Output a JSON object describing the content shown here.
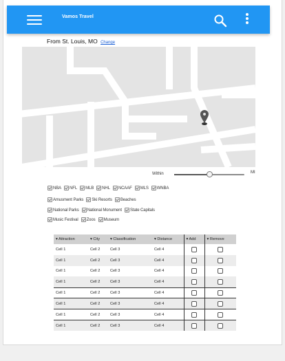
{
  "app": {
    "title": "Vamos Travel",
    "icons": {
      "menu": "hamburger-menu-icon",
      "search": "search-icon",
      "more": "more-vert-icon"
    },
    "brand_color": "#2196f3"
  },
  "location": {
    "text": "From St. Louis, MO",
    "change_label": "Change"
  },
  "map": {
    "marker": "map-pin-icon"
  },
  "distance": {
    "within_label": "Within",
    "unit_label": "MI",
    "value_fraction": 0.5
  },
  "filters": {
    "rows": [
      [
        {
          "label": "NBA",
          "checked": true
        },
        {
          "label": "NFL",
          "checked": true
        },
        {
          "label": "MLB",
          "checked": true
        },
        {
          "label": "NHL",
          "checked": true
        },
        {
          "label": "NCAAF",
          "checked": true
        },
        {
          "label": "MLS",
          "checked": true
        },
        {
          "label": "WNBA",
          "checked": true
        }
      ],
      [
        {
          "label": "Amusment Parks",
          "checked": true
        },
        {
          "label": "Ski Resorts",
          "checked": true
        },
        {
          "label": "Beaches",
          "checked": true
        }
      ],
      [
        {
          "label": "National Parks",
          "checked": true
        },
        {
          "label": "National Monument",
          "checked": true
        },
        {
          "label": "State Capitals",
          "checked": true
        }
      ],
      [
        {
          "label": "Music Festival",
          "checked": true
        },
        {
          "label": "Zoos",
          "checked": true
        },
        {
          "label": "Museum",
          "checked": true
        }
      ]
    ]
  },
  "table": {
    "headers": [
      "▾ Attraction",
      "▾ City",
      "▾ Classification",
      "▾ Distance",
      "▾ Add",
      "▾ Remove"
    ],
    "rows": [
      [
        "Cell 1",
        "Cell 2",
        "Cell 3",
        "Cell 4"
      ],
      [
        "Cell 1",
        "Cell 2",
        "Cell 3",
        "Cell 4"
      ],
      [
        "Cell 1",
        "Cell 2",
        "Cell 3",
        "Cell 4"
      ],
      [
        "Cell 1",
        "Cell 2",
        "Cell 3",
        "Cell 4"
      ],
      [
        "Cell 1",
        "Cell 2",
        "Cell 3",
        "Cell 4"
      ],
      [
        "Cell 1",
        "Cell 2",
        "Cell 3",
        "Cell 4"
      ],
      [
        "Cell 1",
        "Cell 2",
        "Cell 3",
        "Cell 4"
      ],
      [
        "Cell 1",
        "Cell 2",
        "Cell 3",
        "Cell 4"
      ]
    ]
  }
}
